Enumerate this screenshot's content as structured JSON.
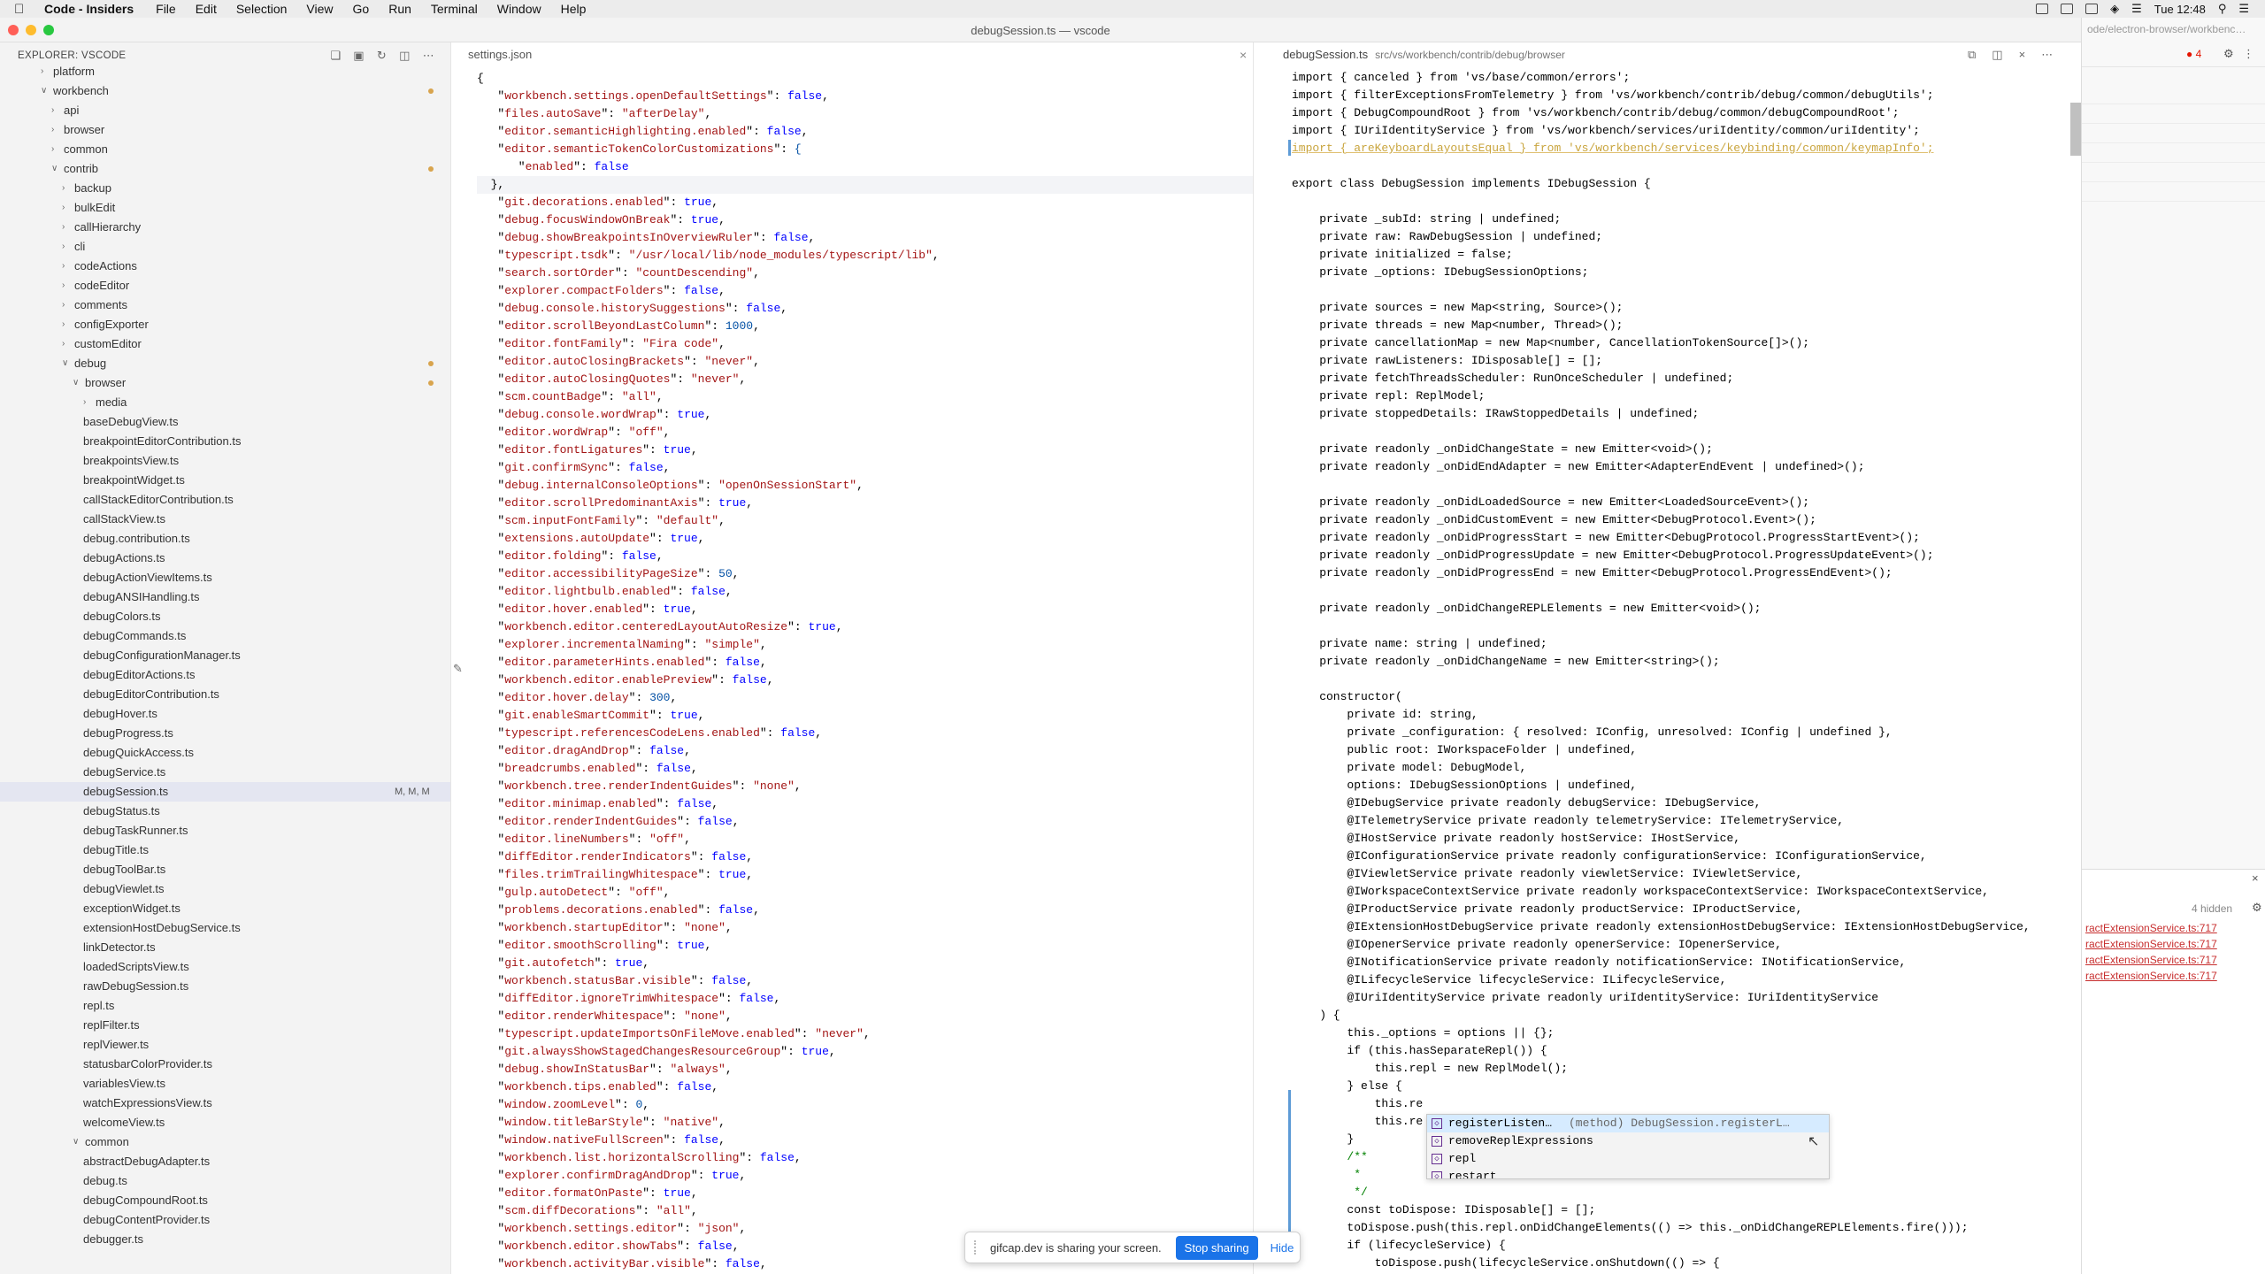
{
  "menubar": {
    "app": "Code - Insiders",
    "items": [
      "File",
      "Edit",
      "Selection",
      "View",
      "Go",
      "Run",
      "Terminal",
      "Window",
      "Help"
    ],
    "clock": "Tue 12:48"
  },
  "window": {
    "title": "debugSession.ts — vscode"
  },
  "explorer": {
    "title": "EXPLORER: VSCODE",
    "items": [
      {
        "label": "platform",
        "depth": 1,
        "type": "folder-collapsed",
        "dot": false
      },
      {
        "label": "workbench",
        "depth": 1,
        "type": "folder-open",
        "dot": true
      },
      {
        "label": "api",
        "depth": 2,
        "type": "folder-collapsed",
        "dot": false
      },
      {
        "label": "browser",
        "depth": 2,
        "type": "folder-collapsed",
        "dot": false
      },
      {
        "label": "common",
        "depth": 2,
        "type": "folder-collapsed",
        "dot": false
      },
      {
        "label": "contrib",
        "depth": 2,
        "type": "folder-open",
        "dot": true
      },
      {
        "label": "backup",
        "depth": 3,
        "type": "folder-collapsed",
        "dot": false
      },
      {
        "label": "bulkEdit",
        "depth": 3,
        "type": "folder-collapsed",
        "dot": false
      },
      {
        "label": "callHierarchy",
        "depth": 3,
        "type": "folder-collapsed",
        "dot": false
      },
      {
        "label": "cli",
        "depth": 3,
        "type": "folder-collapsed",
        "dot": false
      },
      {
        "label": "codeActions",
        "depth": 3,
        "type": "folder-collapsed",
        "dot": false
      },
      {
        "label": "codeEditor",
        "depth": 3,
        "type": "folder-collapsed",
        "dot": false
      },
      {
        "label": "comments",
        "depth": 3,
        "type": "folder-collapsed",
        "dot": false
      },
      {
        "label": "configExporter",
        "depth": 3,
        "type": "folder-collapsed",
        "dot": false
      },
      {
        "label": "customEditor",
        "depth": 3,
        "type": "folder-collapsed",
        "dot": false
      },
      {
        "label": "debug",
        "depth": 3,
        "type": "folder-open",
        "dot": true
      },
      {
        "label": "browser",
        "depth": 4,
        "type": "folder-open",
        "dot": true
      },
      {
        "label": "media",
        "depth": 5,
        "type": "folder-collapsed",
        "dot": false
      },
      {
        "label": "baseDebugView.ts",
        "depth": 5,
        "type": "file",
        "dot": false
      },
      {
        "label": "breakpointEditorContribution.ts",
        "depth": 5,
        "type": "file",
        "dot": false
      },
      {
        "label": "breakpointsView.ts",
        "depth": 5,
        "type": "file",
        "dot": false
      },
      {
        "label": "breakpointWidget.ts",
        "depth": 5,
        "type": "file",
        "dot": false
      },
      {
        "label": "callStackEditorContribution.ts",
        "depth": 5,
        "type": "file",
        "dot": false
      },
      {
        "label": "callStackView.ts",
        "depth": 5,
        "type": "file",
        "dot": false
      },
      {
        "label": "debug.contribution.ts",
        "depth": 5,
        "type": "file",
        "dot": false
      },
      {
        "label": "debugActions.ts",
        "depth": 5,
        "type": "file",
        "dot": false
      },
      {
        "label": "debugActionViewItems.ts",
        "depth": 5,
        "type": "file",
        "dot": false
      },
      {
        "label": "debugANSIHandling.ts",
        "depth": 5,
        "type": "file",
        "dot": false
      },
      {
        "label": "debugColors.ts",
        "depth": 5,
        "type": "file",
        "dot": false
      },
      {
        "label": "debugCommands.ts",
        "depth": 5,
        "type": "file",
        "dot": false
      },
      {
        "label": "debugConfigurationManager.ts",
        "depth": 5,
        "type": "file",
        "dot": false
      },
      {
        "label": "debugEditorActions.ts",
        "depth": 5,
        "type": "file",
        "dot": false
      },
      {
        "label": "debugEditorContribution.ts",
        "depth": 5,
        "type": "file",
        "dot": false
      },
      {
        "label": "debugHover.ts",
        "depth": 5,
        "type": "file",
        "dot": false
      },
      {
        "label": "debugProgress.ts",
        "depth": 5,
        "type": "file",
        "dot": false
      },
      {
        "label": "debugQuickAccess.ts",
        "depth": 5,
        "type": "file",
        "dot": false
      },
      {
        "label": "debugService.ts",
        "depth": 5,
        "type": "file",
        "dot": false
      },
      {
        "label": "debugSession.ts",
        "depth": 5,
        "type": "file",
        "dot": false,
        "selected": true,
        "badge": "M, M, M"
      },
      {
        "label": "debugStatus.ts",
        "depth": 5,
        "type": "file",
        "dot": false
      },
      {
        "label": "debugTaskRunner.ts",
        "depth": 5,
        "type": "file",
        "dot": false
      },
      {
        "label": "debugTitle.ts",
        "depth": 5,
        "type": "file",
        "dot": false
      },
      {
        "label": "debugToolBar.ts",
        "depth": 5,
        "type": "file",
        "dot": false
      },
      {
        "label": "debugViewlet.ts",
        "depth": 5,
        "type": "file",
        "dot": false
      },
      {
        "label": "exceptionWidget.ts",
        "depth": 5,
        "type": "file",
        "dot": false
      },
      {
        "label": "extensionHostDebugService.ts",
        "depth": 5,
        "type": "file",
        "dot": false
      },
      {
        "label": "linkDetector.ts",
        "depth": 5,
        "type": "file",
        "dot": false
      },
      {
        "label": "loadedScriptsView.ts",
        "depth": 5,
        "type": "file",
        "dot": false
      },
      {
        "label": "rawDebugSession.ts",
        "depth": 5,
        "type": "file",
        "dot": false
      },
      {
        "label": "repl.ts",
        "depth": 5,
        "type": "file",
        "dot": false
      },
      {
        "label": "replFilter.ts",
        "depth": 5,
        "type": "file",
        "dot": false
      },
      {
        "label": "replViewer.ts",
        "depth": 5,
        "type": "file",
        "dot": false
      },
      {
        "label": "statusbarColorProvider.ts",
        "depth": 5,
        "type": "file",
        "dot": false
      },
      {
        "label": "variablesView.ts",
        "depth": 5,
        "type": "file",
        "dot": false
      },
      {
        "label": "watchExpressionsView.ts",
        "depth": 5,
        "type": "file",
        "dot": false
      },
      {
        "label": "welcomeView.ts",
        "depth": 5,
        "type": "file",
        "dot": false
      },
      {
        "label": "common",
        "depth": 4,
        "type": "folder-open",
        "dot": false
      },
      {
        "label": "abstractDebugAdapter.ts",
        "depth": 5,
        "type": "file",
        "dot": false
      },
      {
        "label": "debug.ts",
        "depth": 5,
        "type": "file",
        "dot": false
      },
      {
        "label": "debugCompoundRoot.ts",
        "depth": 5,
        "type": "file",
        "dot": false
      },
      {
        "label": "debugContentProvider.ts",
        "depth": 5,
        "type": "file",
        "dot": false
      },
      {
        "label": "debugger.ts",
        "depth": 5,
        "type": "file",
        "dot": false
      }
    ]
  },
  "settings_editor": {
    "tab": "settings.json",
    "lines": [
      {
        "k": "",
        "v": "{",
        "raw": true
      },
      {
        "k": "workbench.settings.openDefaultSettings",
        "v": "false"
      },
      {
        "k": "files.autoSave",
        "v": "\"afterDelay\""
      },
      {
        "k": "editor.semanticHighlighting.enabled",
        "v": "false"
      },
      {
        "k": "editor.semanticTokenColorCustomizations",
        "v": "{"
      },
      {
        "k": "enabled",
        "v": "false",
        "indent": 2,
        "last": true
      },
      {
        "k": "",
        "v": "  },",
        "raw": true,
        "hl": true
      },
      {
        "k": "git.decorations.enabled",
        "v": "true"
      },
      {
        "k": "debug.focusWindowOnBreak",
        "v": "true"
      },
      {
        "k": "debug.showBreakpointsInOverviewRuler",
        "v": "false"
      },
      {
        "k": "typescript.tsdk",
        "v": "\"/usr/local/lib/node_modules/typescript/lib\""
      },
      {
        "k": "search.sortOrder",
        "v": "\"countDescending\""
      },
      {
        "k": "explorer.compactFolders",
        "v": "false"
      },
      {
        "k": "debug.console.historySuggestions",
        "v": "false"
      },
      {
        "k": "editor.scrollBeyondLastColumn",
        "v": "1000"
      },
      {
        "k": "editor.fontFamily",
        "v": "\"Fira code\""
      },
      {
        "k": "editor.autoClosingBrackets",
        "v": "\"never\""
      },
      {
        "k": "editor.autoClosingQuotes",
        "v": "\"never\""
      },
      {
        "k": "scm.countBadge",
        "v": "\"all\""
      },
      {
        "k": "debug.console.wordWrap",
        "v": "true"
      },
      {
        "k": "editor.wordWrap",
        "v": "\"off\""
      },
      {
        "k": "editor.fontLigatures",
        "v": "true"
      },
      {
        "k": "git.confirmSync",
        "v": "false"
      },
      {
        "k": "debug.internalConsoleOptions",
        "v": "\"openOnSessionStart\""
      },
      {
        "k": "editor.scrollPredominantAxis",
        "v": "true"
      },
      {
        "k": "scm.inputFontFamily",
        "v": "\"default\""
      },
      {
        "k": "extensions.autoUpdate",
        "v": "true"
      },
      {
        "k": "editor.folding",
        "v": "false"
      },
      {
        "k": "editor.accessibilityPageSize",
        "v": "50"
      },
      {
        "k": "editor.lightbulb.enabled",
        "v": "false"
      },
      {
        "k": "editor.hover.enabled",
        "v": "true"
      },
      {
        "k": "workbench.editor.centeredLayoutAutoResize",
        "v": "true"
      },
      {
        "k": "explorer.incrementalNaming",
        "v": "\"simple\""
      },
      {
        "k": "editor.parameterHints.enabled",
        "v": "false"
      },
      {
        "k": "workbench.editor.enablePreview",
        "v": "false"
      },
      {
        "k": "editor.hover.delay",
        "v": "300"
      },
      {
        "k": "git.enableSmartCommit",
        "v": "true"
      },
      {
        "k": "typescript.referencesCodeLens.enabled",
        "v": "false"
      },
      {
        "k": "editor.dragAndDrop",
        "v": "false"
      },
      {
        "k": "breadcrumbs.enabled",
        "v": "false"
      },
      {
        "k": "workbench.tree.renderIndentGuides",
        "v": "\"none\""
      },
      {
        "k": "editor.minimap.enabled",
        "v": "false"
      },
      {
        "k": "editor.renderIndentGuides",
        "v": "false"
      },
      {
        "k": "editor.lineNumbers",
        "v": "\"off\""
      },
      {
        "k": "diffEditor.renderIndicators",
        "v": "false"
      },
      {
        "k": "files.trimTrailingWhitespace",
        "v": "true"
      },
      {
        "k": "gulp.autoDetect",
        "v": "\"off\""
      },
      {
        "k": "problems.decorations.enabled",
        "v": "false"
      },
      {
        "k": "workbench.startupEditor",
        "v": "\"none\""
      },
      {
        "k": "editor.smoothScrolling",
        "v": "true"
      },
      {
        "k": "git.autofetch",
        "v": "true"
      },
      {
        "k": "workbench.statusBar.visible",
        "v": "false"
      },
      {
        "k": "diffEditor.ignoreTrimWhitespace",
        "v": "false"
      },
      {
        "k": "editor.renderWhitespace",
        "v": "\"none\""
      },
      {
        "k": "typescript.updateImportsOnFileMove.enabled",
        "v": "\"never\""
      },
      {
        "k": "git.alwaysShowStagedChangesResourceGroup",
        "v": "true"
      },
      {
        "k": "debug.showInStatusBar",
        "v": "\"always\""
      },
      {
        "k": "workbench.tips.enabled",
        "v": "false"
      },
      {
        "k": "window.zoomLevel",
        "v": "0"
      },
      {
        "k": "window.titleBarStyle",
        "v": "\"native\""
      },
      {
        "k": "window.nativeFullScreen",
        "v": "false"
      },
      {
        "k": "workbench.list.horizontalScrolling",
        "v": "false"
      },
      {
        "k": "explorer.confirmDragAndDrop",
        "v": "true"
      },
      {
        "k": "editor.formatOnPaste",
        "v": "true"
      },
      {
        "k": "scm.diffDecorations",
        "v": "\"all\""
      },
      {
        "k": "workbench.settings.editor",
        "v": "\"json\""
      },
      {
        "k": "workbench.editor.showTabs",
        "v": "false"
      },
      {
        "k": "workbench.activityBar.visible",
        "v": "false"
      }
    ]
  },
  "code_editor": {
    "tab": "debugSession.ts",
    "path": "src/vs/workbench/contrib/debug/browser",
    "lines": [
      "import { canceled } from 'vs/base/common/errors';",
      "import { filterExceptionsFromTelemetry } from 'vs/workbench/contrib/debug/common/debugUtils';",
      "import { DebugCompoundRoot } from 'vs/workbench/contrib/debug/common/debugCompoundRoot';",
      "import { IUriIdentityService } from 'vs/workbench/services/uriIdentity/common/uriIdentity';",
      "import { areKeyboardLayoutsEqual } from 'vs/workbench/services/keybinding/common/keymapInfo';",
      "",
      "export class DebugSession implements IDebugSession {",
      "",
      "    private _subId: string | undefined;",
      "    private raw: RawDebugSession | undefined;",
      "    private initialized = false;",
      "    private _options: IDebugSessionOptions;",
      "",
      "    private sources = new Map<string, Source>();",
      "    private threads = new Map<number, Thread>();",
      "    private cancellationMap = new Map<number, CancellationTokenSource[]>();",
      "    private rawListeners: IDisposable[] = [];",
      "    private fetchThreadsScheduler: RunOnceScheduler | undefined;",
      "    private repl: ReplModel;",
      "    private stoppedDetails: IRawStoppedDetails | undefined;",
      "",
      "    private readonly _onDidChangeState = new Emitter<void>();",
      "    private readonly _onDidEndAdapter = new Emitter<AdapterEndEvent | undefined>();",
      "",
      "    private readonly _onDidLoadedSource = new Emitter<LoadedSourceEvent>();",
      "    private readonly _onDidCustomEvent = new Emitter<DebugProtocol.Event>();",
      "    private readonly _onDidProgressStart = new Emitter<DebugProtocol.ProgressStartEvent>();",
      "    private readonly _onDidProgressUpdate = new Emitter<DebugProtocol.ProgressUpdateEvent>();",
      "    private readonly _onDidProgressEnd = new Emitter<DebugProtocol.ProgressEndEvent>();",
      "",
      "    private readonly _onDidChangeREPLElements = new Emitter<void>();",
      "",
      "    private name: string | undefined;",
      "    private readonly _onDidChangeName = new Emitter<string>();",
      "",
      "    constructor(",
      "        private id: string,",
      "        private _configuration: { resolved: IConfig, unresolved: IConfig | undefined },",
      "        public root: IWorkspaceFolder | undefined,",
      "        private model: DebugModel,",
      "        options: IDebugSessionOptions | undefined,",
      "        @IDebugService private readonly debugService: IDebugService,",
      "        @ITelemetryService private readonly telemetryService: ITelemetryService,",
      "        @IHostService private readonly hostService: IHostService,",
      "        @IConfigurationService private readonly configurationService: IConfigurationService,",
      "        @IViewletService private readonly viewletService: IViewletService,",
      "        @IWorkspaceContextService private readonly workspaceContextService: IWorkspaceContextService,",
      "        @IProductService private readonly productService: IProductService,",
      "        @IExtensionHostDebugService private readonly extensionHostDebugService: IExtensionHostDebugService,",
      "        @IOpenerService private readonly openerService: IOpenerService,",
      "        @INotificationService private readonly notificationService: INotificationService,",
      "        @ILifecycleService lifecycleService: ILifecycleService,",
      "        @IUriIdentityService private readonly uriIdentityService: IUriIdentityService",
      "    ) {",
      "        this._options = options || {};",
      "        if (this.hasSeparateRepl()) {",
      "            this.repl = new ReplModel();",
      "        } else {",
      "            this.re",
      "            this.re",
      "        }",
      "        /**",
      "         *",
      "         */",
      "        const toDispose: IDisposable[] = [];",
      "        toDispose.push(this.repl.onDidChangeElements(() => this._onDidChangeREPLElements.fire()));",
      "        if (lifecycleService) {",
      "            toDispose.push(lifecycleService.onShutdown(() => {"
    ]
  },
  "suggest": {
    "items": [
      {
        "label": "registerListen…",
        "detail": "(method) DebugSession.registerL…",
        "active": true
      },
      {
        "label": "removeReplExpressions",
        "detail": ""
      },
      {
        "label": "repl",
        "detail": ""
      },
      {
        "label": "restart",
        "detail": ""
      }
    ]
  },
  "right_window": {
    "url": "ode/electron-browser/workbenc…",
    "errors": "4",
    "hidden": "4 hidden",
    "links": [
      "ractExtensionService.ts:717",
      "ractExtensionService.ts:717",
      "ractExtensionService.ts:717",
      "ractExtensionService.ts:717"
    ]
  },
  "share_popup": {
    "text": "gifcap.dev is sharing your screen.",
    "stop": "Stop sharing",
    "hide": "Hide"
  },
  "colors": {
    "accent": "#1a73e8",
    "selected_row": "#e4e6f1",
    "modified_dot": "#d8a44d",
    "error": "#e51400"
  }
}
